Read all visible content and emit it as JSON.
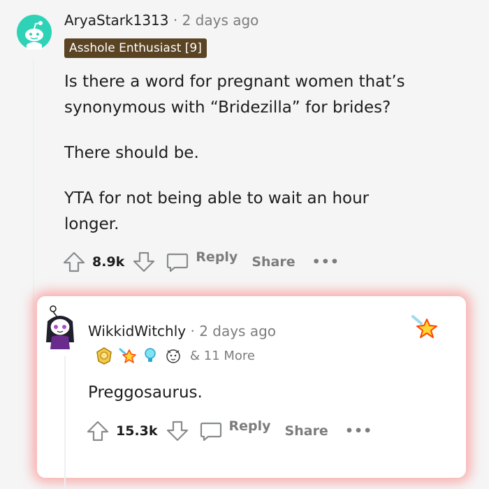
{
  "comment": {
    "username": "AryaStark1313",
    "separator": "·",
    "age": "2 days ago",
    "flair": "Asshole Enthusiast [9]",
    "paragraphs": [
      "Is there a word for pregnant women that’s synonymous with “Bridezilla” for brides?",
      "There should be.",
      "YTA for not being able to wait an hour longer."
    ],
    "score": "8.9k",
    "reply_label": "Reply",
    "share_label": "Share",
    "more_label": "•••"
  },
  "reply": {
    "username": "WikkidWitchly",
    "separator": "·",
    "age": "2 days ago",
    "more_awards": "& 11 More",
    "body": "Preggosaurus.",
    "score": "15.3k",
    "reply_label": "Reply",
    "share_label": "Share",
    "more_label": "•••"
  },
  "icons": {
    "avatar_1": "reddit-snoo-avatar",
    "avatar_2": "witch-snoo-avatar",
    "upvote": "upvote-arrow-icon",
    "downvote": "downvote-arrow-icon",
    "comment": "speech-bubble-icon",
    "awards": [
      "gold-medal-award",
      "starstruck-award",
      "lightbulb-award",
      "squishy-award",
      "star-award"
    ]
  },
  "colors": {
    "avatar_bg": "#2ed3b7",
    "flair_bg": "#5b4424",
    "card_glow": "#ff6b6b",
    "muted_text": "#7c7c7c"
  }
}
